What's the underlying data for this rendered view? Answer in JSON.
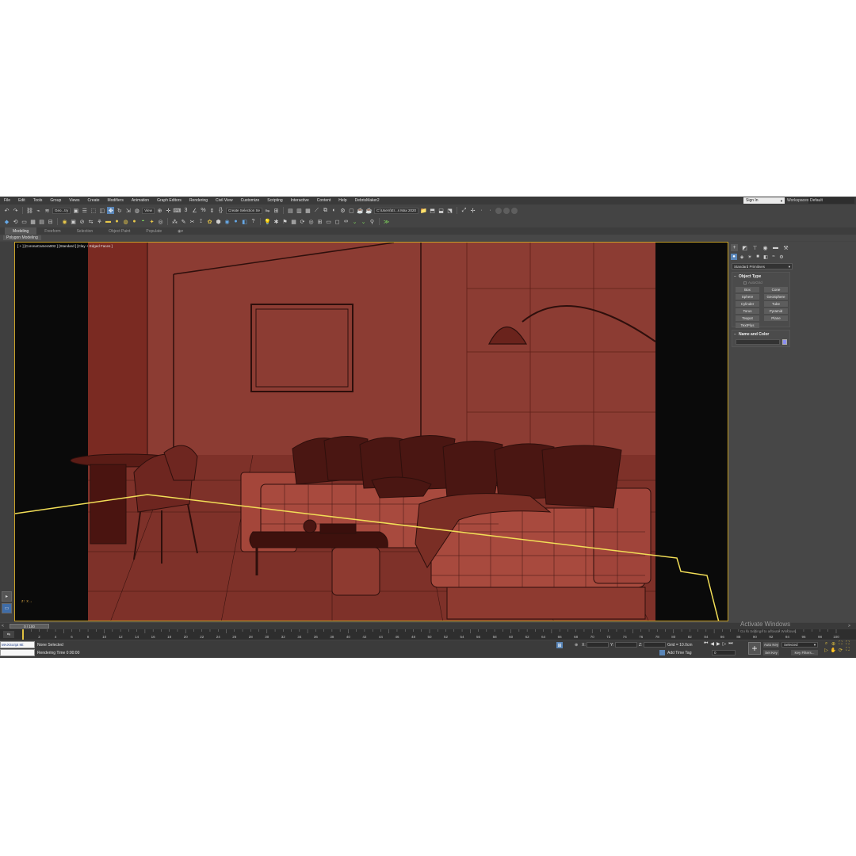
{
  "menu": [
    "File",
    "Edit",
    "Tools",
    "Group",
    "Views",
    "Create",
    "Modifiers",
    "Animation",
    "Graph Editors",
    "Rendering",
    "Civil View",
    "Customize",
    "Scripting",
    "Interactive",
    "Content",
    "Help",
    "DebrisMaker2"
  ],
  "signin": "Sign In",
  "workspace": {
    "label": "Workspaces:",
    "value": "Default"
  },
  "toolbar": {
    "selection_filter": "Geo...try",
    "ref_coord": "View",
    "named_selection": "Create Selection Se",
    "project_path": "C:\\Users\\Er...s Max 2020"
  },
  "ribbon": {
    "tabs": [
      "Modeling",
      "Freeform",
      "Selection",
      "Object Paint",
      "Populate"
    ],
    "sub": "Polygon Modeling"
  },
  "viewport": {
    "label": "[ + ] [CoronaCamera002 ] [Standard ] [Clay + Edged Faces ]",
    "colors": {
      "render_bg": "#8c3c33",
      "wire": "#2e0f0c",
      "curve": "#f2de57",
      "frame": "#c9a227"
    }
  },
  "command_panel": {
    "category": "Standard Primitives",
    "object_type": {
      "title": "Object Type",
      "autogrid": "AutoGrid",
      "buttons": [
        "Box",
        "Cone",
        "Sphere",
        "GeoSphere",
        "Cylinder",
        "Tube",
        "Torus",
        "Pyramid",
        "Teapot",
        "Plane",
        "TextPlus"
      ]
    },
    "name_color": {
      "title": "Name and Color"
    }
  },
  "timeline": {
    "slider": "0 / 100",
    "ticks": [
      "0",
      "2",
      "4",
      "6",
      "8",
      "10",
      "12",
      "14",
      "16",
      "18",
      "20",
      "22",
      "24",
      "26",
      "28",
      "30",
      "32",
      "34",
      "36",
      "38",
      "40",
      "42",
      "44",
      "46",
      "48",
      "50",
      "52",
      "54",
      "56",
      "58",
      "60",
      "62",
      "64",
      "66",
      "68",
      "70",
      "72",
      "74",
      "76",
      "78",
      "80",
      "82",
      "84",
      "86",
      "88",
      "90",
      "92",
      "94",
      "96",
      "98",
      "100"
    ]
  },
  "status": {
    "maxscript": "MAXScript Mi:",
    "selection": "None Selected",
    "render_time": "Rendering Time  0:00:00",
    "x": "X:",
    "y": "Y:",
    "z": "Z:",
    "grid": "Grid = 10.0cm",
    "add_time_tag": "Add Time Tag",
    "frame": "0",
    "auto_key": "Auto Key",
    "set_key": "Set Key",
    "selected": "Selected",
    "key_filters": "Key Filters..."
  },
  "activate": {
    "title": "Activate Windows",
    "subtitle": "Go to Settings to activate Windows."
  }
}
